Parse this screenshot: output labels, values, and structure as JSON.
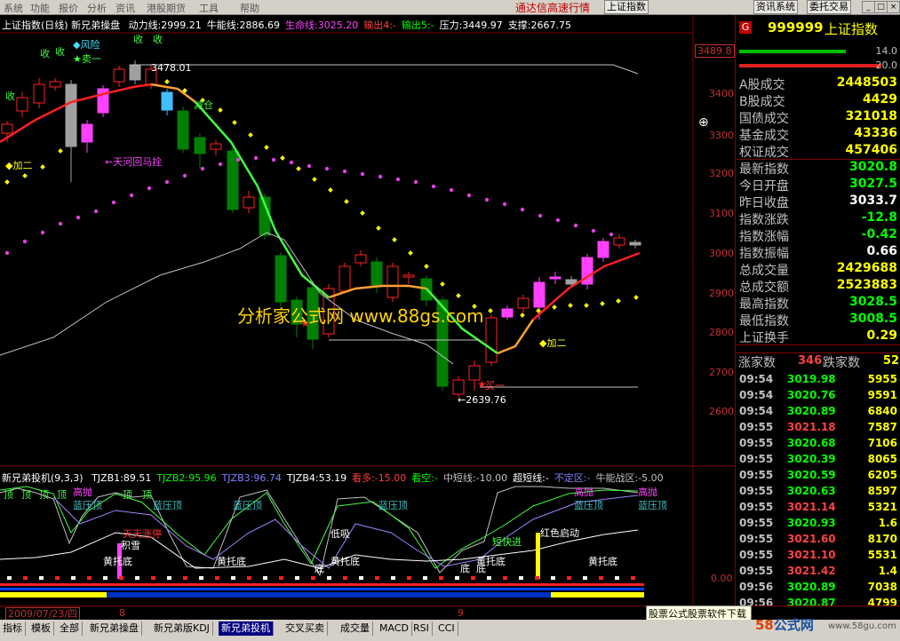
{
  "menu": {
    "items": [
      "系统",
      "功能",
      "报价",
      "分析",
      "资讯",
      "港股期货",
      "工具",
      "帮助"
    ],
    "marquee": "通达信高速行情",
    "index_label": "上证指数",
    "btn_news": "资讯系统",
    "btn_trade": "委托交易"
  },
  "main_chart": {
    "title": "上证指数(日线)",
    "indicator": "新兄弟操盘",
    "items": [
      {
        "label": "动力线:2999.21",
        "color": "#ffffff"
      },
      {
        "label": "牛能线:2886.69",
        "color": "#ffffff"
      },
      {
        "label": "生命线:3025.20",
        "color": "#ff40ff"
      },
      {
        "label": "输出4:-",
        "color": "#ff4040"
      },
      {
        "label": "输出5:-",
        "color": "#00ff00"
      },
      {
        "label": "压力:3449.97",
        "color": "#ffffff"
      },
      {
        "label": "支撑:2667.75",
        "color": "#ffffff"
      }
    ],
    "price_top_box": "3489.8",
    "axis_ticks": [
      "3400",
      "3300",
      "3200",
      "3100",
      "3000",
      "2900",
      "2800",
      "2700",
      "2600"
    ],
    "high_label": "3478.01",
    "low_label": "←2639.76",
    "annotations": {
      "risk": "◆风险",
      "sell1": "★卖一",
      "reduce": "减仓",
      "add2_left": "◆加二",
      "horse": "←天河回马拴",
      "add2_right": "◆加二",
      "buy1": "买一",
      "shou": "收"
    },
    "watermark": "分析家公式网 www.88gs.com"
  },
  "sub_chart": {
    "title": "新兄弟投机(9,3,3)",
    "items": [
      {
        "label": "TJZB1:89.51",
        "color": "#ffffff"
      },
      {
        "label": "TJZB2:95.96",
        "color": "#00ff00"
      },
      {
        "label": "TJZB3:96.74",
        "color": "#8080ff"
      },
      {
        "label": "TJZB4:53.19",
        "color": "#ffffff"
      },
      {
        "label": "看多:-15.00",
        "color": "#ff4040"
      },
      {
        "label": "看空:-",
        "color": "#00ff00"
      },
      {
        "label": "中短线:-10.00",
        "color": "#c0c0c0"
      },
      {
        "label": "超短线:-",
        "color": "#ffffff"
      },
      {
        "label": "不定区:-",
        "color": "#8080ff"
      },
      {
        "label": "牛能战区:-5.00",
        "color": "#c0c0c0"
      }
    ],
    "zero_tick": "0.00",
    "labels": {
      "top": "顶",
      "high_throw": "高抛",
      "blue_press": "蓝压顶",
      "heaven_stop": "天天涨停",
      "accum": "积雪",
      "yellow_support": "黄托底",
      "low_suck": "低吸",
      "bottom": "底",
      "fast_in": "短快进",
      "red_start": "红色启动"
    }
  },
  "info": {
    "code_badge": "G",
    "code": "999999",
    "name": "上证指数",
    "bar1_value": "14.0",
    "bar2_value": "20.0",
    "rows": [
      {
        "k": "A股成交",
        "v": "2448503",
        "c": "#ffff00"
      },
      {
        "k": "B股成交",
        "v": "4429",
        "c": "#ffff00"
      },
      {
        "k": "国债成交",
        "v": "321018",
        "c": "#ffff00"
      },
      {
        "k": "基金成交",
        "v": "43336",
        "c": "#ffff00"
      },
      {
        "k": "权证成交",
        "v": "457406",
        "c": "#ffff00"
      },
      {
        "k": "最新指数",
        "v": "3020.8",
        "c": "#00ff00"
      },
      {
        "k": "今日开盘",
        "v": "3027.5",
        "c": "#00ff00"
      },
      {
        "k": "昨日收盘",
        "v": "3033.7",
        "c": "#ffffff"
      },
      {
        "k": "指数涨跌",
        "v": "-12.8",
        "c": "#00ff00"
      },
      {
        "k": "指数涨幅",
        "v": "-0.42",
        "c": "#00ff00"
      },
      {
        "k": "指数振幅",
        "v": "0.66",
        "c": "#ffffff"
      },
      {
        "k": "总成交量",
        "v": "2429688",
        "c": "#ffff00"
      },
      {
        "k": "总成交额",
        "v": "2523883",
        "c": "#ffff00"
      },
      {
        "k": "最高指数",
        "v": "3028.5",
        "c": "#00ff00"
      },
      {
        "k": "最低指数",
        "v": "3008.5",
        "c": "#00ff00"
      },
      {
        "k": "上证换手",
        "v": "0.29",
        "c": "#ffff00"
      }
    ],
    "up_label": "涨家数",
    "up_value": "346",
    "down_label": "跌家数",
    "down_value": "52",
    "ticks": [
      [
        "09:54",
        "3019.98",
        "5955"
      ],
      [
        "09:54",
        "3020.76",
        "9591"
      ],
      [
        "09:54",
        "3020.89",
        "6840"
      ],
      [
        "09:55",
        "3021.18",
        "7587"
      ],
      [
        "09:55",
        "3020.68",
        "7106"
      ],
      [
        "09:55",
        "3020.39",
        "8065"
      ],
      [
        "09:55",
        "3020.59",
        "6205"
      ],
      [
        "09:55",
        "3020.63",
        "8597"
      ],
      [
        "09:55",
        "3021.14",
        "5321"
      ],
      [
        "09:55",
        "3020.93",
        "1.6"
      ],
      [
        "09:55",
        "3021.60",
        "8170"
      ],
      [
        "09:55",
        "3021.10",
        "5531"
      ],
      [
        "09:55",
        "3021.42",
        "1.4"
      ],
      [
        "09:56",
        "3020.89",
        "7038"
      ],
      [
        "09:56",
        "3020.87",
        "4799"
      ]
    ]
  },
  "bottom": {
    "date": "2009/07/23/四",
    "mark8": "8",
    "mark9": "9",
    "ad": "股票公式股票软件下载",
    "logo_num": "58",
    "logo_txt": "公式网",
    "url": "www.58gu.com"
  },
  "tabs": [
    "指标",
    "模板",
    "全部",
    "新兄弟操盘",
    "新兄弟版KDJ",
    "新兄弟投机",
    "交叉买卖",
    "成交量",
    "MACD",
    "RSI",
    "CCI"
  ],
  "active_tab": "新兄弟投机"
}
